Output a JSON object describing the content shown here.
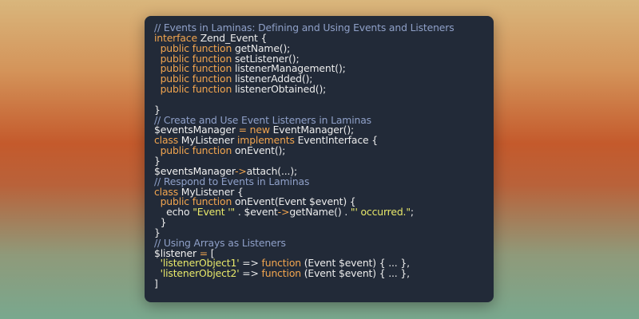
{
  "editor": {
    "lines": [
      [
        {
          "t": "comment",
          "v": "// Events in Laminas: Defining and Using Events and Listeners"
        }
      ],
      [
        {
          "t": "kw",
          "v": "interface"
        },
        {
          "t": "plain",
          "v": " Zend_Event {"
        }
      ],
      [
        {
          "t": "plain",
          "v": "  "
        },
        {
          "t": "kw",
          "v": "public function"
        },
        {
          "t": "plain",
          "v": " getName();"
        }
      ],
      [
        {
          "t": "plain",
          "v": "  "
        },
        {
          "t": "kw",
          "v": "public function"
        },
        {
          "t": "plain",
          "v": " setListener();"
        }
      ],
      [
        {
          "t": "plain",
          "v": "  "
        },
        {
          "t": "kw",
          "v": "public function"
        },
        {
          "t": "plain",
          "v": " listenerManagement();"
        }
      ],
      [
        {
          "t": "plain",
          "v": "  "
        },
        {
          "t": "kw",
          "v": "public function"
        },
        {
          "t": "plain",
          "v": " listenerAdded();"
        }
      ],
      [
        {
          "t": "plain",
          "v": "  "
        },
        {
          "t": "kw",
          "v": "public function"
        },
        {
          "t": "plain",
          "v": " listenerObtained();"
        }
      ],
      [
        {
          "t": "plain",
          "v": ""
        }
      ],
      [
        {
          "t": "plain",
          "v": "}"
        }
      ],
      [
        {
          "t": "comment",
          "v": "// Create and Use Event Listeners in Laminas"
        }
      ],
      [
        {
          "t": "var",
          "v": "$eventsManager"
        },
        {
          "t": "plain",
          "v": " "
        },
        {
          "t": "op",
          "v": "="
        },
        {
          "t": "plain",
          "v": " "
        },
        {
          "t": "kw",
          "v": "new"
        },
        {
          "t": "plain",
          "v": " EventManager();"
        }
      ],
      [
        {
          "t": "kw",
          "v": "class"
        },
        {
          "t": "plain",
          "v": " MyListener "
        },
        {
          "t": "kw",
          "v": "implements"
        },
        {
          "t": "plain",
          "v": " EventInterface {"
        }
      ],
      [
        {
          "t": "plain",
          "v": "  "
        },
        {
          "t": "kw",
          "v": "public function"
        },
        {
          "t": "plain",
          "v": " onEvent();"
        }
      ],
      [
        {
          "t": "plain",
          "v": "}"
        }
      ],
      [
        {
          "t": "var",
          "v": "$eventsManager"
        },
        {
          "t": "op",
          "v": "->"
        },
        {
          "t": "plain",
          "v": "attach(...);"
        }
      ],
      [
        {
          "t": "comment",
          "v": "// Respond to Events in Laminas"
        }
      ],
      [
        {
          "t": "kw",
          "v": "class"
        },
        {
          "t": "plain",
          "v": " MyListener {"
        }
      ],
      [
        {
          "t": "plain",
          "v": "  "
        },
        {
          "t": "kw",
          "v": "public function"
        },
        {
          "t": "plain",
          "v": " onEvent(Event $event) {"
        }
      ],
      [
        {
          "t": "plain",
          "v": "    echo "
        },
        {
          "t": "str",
          "v": "\"Event '\""
        },
        {
          "t": "plain",
          "v": " . $event"
        },
        {
          "t": "op",
          "v": "->"
        },
        {
          "t": "plain",
          "v": "getName() . "
        },
        {
          "t": "str",
          "v": "\"' occurred.\""
        },
        {
          "t": "plain",
          "v": ";"
        }
      ],
      [
        {
          "t": "plain",
          "v": "  }"
        }
      ],
      [
        {
          "t": "plain",
          "v": "}"
        }
      ],
      [
        {
          "t": "comment",
          "v": "// Using Arrays as Listeners"
        }
      ],
      [
        {
          "t": "var",
          "v": "$listener"
        },
        {
          "t": "plain",
          "v": " "
        },
        {
          "t": "op",
          "v": "="
        },
        {
          "t": "plain",
          "v": " ["
        }
      ],
      [
        {
          "t": "plain",
          "v": "  "
        },
        {
          "t": "str",
          "v": "'listenerObject1'"
        },
        {
          "t": "plain",
          "v": " => "
        },
        {
          "t": "kw",
          "v": "function"
        },
        {
          "t": "plain",
          "v": " (Event $event) { ... },"
        }
      ],
      [
        {
          "t": "plain",
          "v": "  "
        },
        {
          "t": "str",
          "v": "'listenerObject2'"
        },
        {
          "t": "plain",
          "v": " => "
        },
        {
          "t": "kw",
          "v": "function"
        },
        {
          "t": "plain",
          "v": " (Event $event) { ... },"
        }
      ],
      [
        {
          "t": "plain",
          "v": "]"
        }
      ]
    ]
  },
  "colors": {
    "window_bg": "#222a38",
    "comment": "#8fa0c8",
    "keyword": "#f2a54f",
    "string": "#e8e86a",
    "text": "#ececec"
  }
}
